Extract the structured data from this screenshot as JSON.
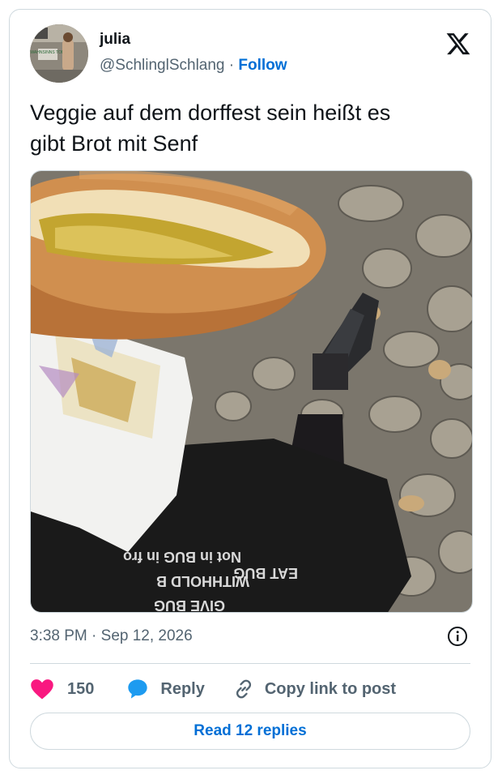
{
  "author": {
    "name": "julia",
    "handle": "@SchlinglSchlang",
    "separator": "·",
    "follow_label": "Follow",
    "avatar_sign_text": "WAHNSINNS TOBI"
  },
  "tweet": {
    "text_line1": "Veggie auf dem dorffest sein heißt es",
    "text_line2": "gibt Brot mit Senf",
    "timestamp": "3:38 PM · Sep 12, 2026"
  },
  "media": {
    "skirt_text_lines": [
      "Not in BUG in fro",
      "WITHHOLD B",
      "GIVE BUG",
      "EAT BUG"
    ]
  },
  "actions": {
    "like_count": "150",
    "reply_label": "Reply",
    "copy_label": "Copy link to post"
  },
  "read_replies_label": "Read 12 replies",
  "colors": {
    "like": "#f91880",
    "reply": "#1d9bf0",
    "link": "#006fd6",
    "muted": "#536471"
  }
}
